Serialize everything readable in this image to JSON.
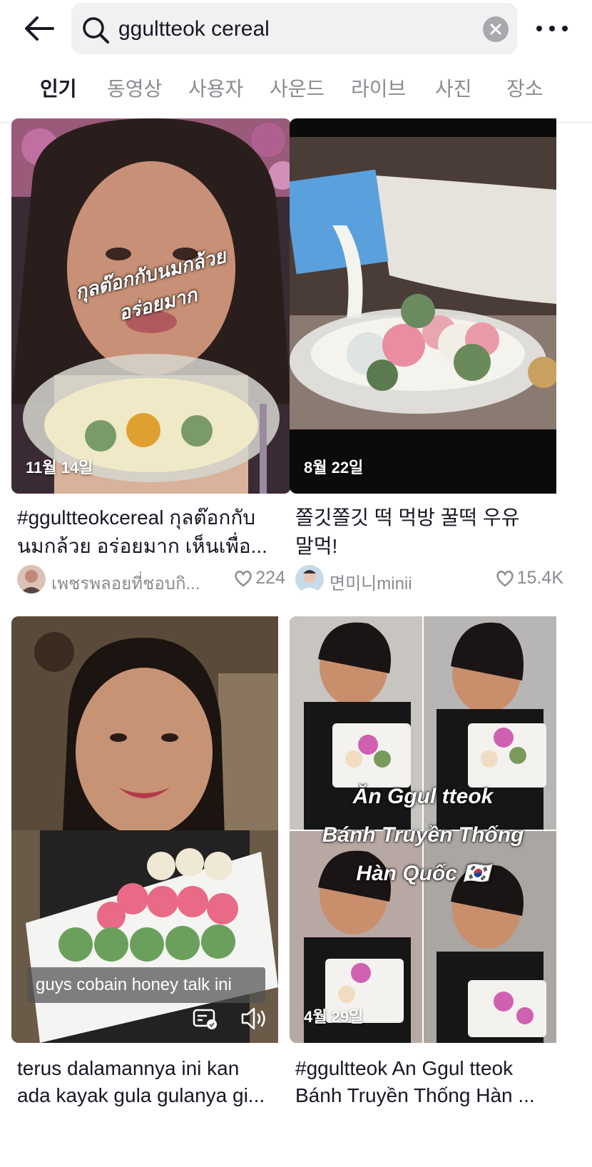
{
  "search": {
    "query": "ggultteok cereal"
  },
  "tabs": [
    {
      "label": "인기"
    },
    {
      "label": "동영상"
    },
    {
      "label": "사용자"
    },
    {
      "label": "사운드"
    },
    {
      "label": "라이브"
    },
    {
      "label": "사진"
    },
    {
      "label": "장소"
    }
  ],
  "active_tab": "인기",
  "cards": [
    {
      "date": "11월 14일",
      "overlay_lines": [
        "กุลต๊อกกับนมกล้วย",
        "อร่อยมาก"
      ],
      "title_line1": "#ggultteokcereal กุลต๊อกกับ",
      "title_line2": "นมกล้วย อร่อยมาก เห็นเพื่อ...",
      "author": "เพชรพลอยที่ชอบกิ...",
      "likes": "224"
    },
    {
      "date": "8월 22일",
      "title_line1": " 쫄깃쫄깃 떡 먹방 꿀떡 우유",
      "title_line2": "말먹!",
      "author": "면미니minii",
      "likes": "15.4K"
    },
    {
      "caption_overlay": "guys cobain honey talk ini",
      "title_line1": "terus dalamannya ini kan",
      "title_line2": "ada kayak gula gulanya gi..."
    },
    {
      "date": "4월 29일",
      "overlay_lines": [
        "Ăn Ggul tteok",
        "Bánh Truyền Thống",
        "Hàn Quốc 🇰🇷"
      ],
      "title_line1": "#ggultteok An Ggul tteok",
      "title_line2": "Bánh Truyền Thống Hàn ..."
    }
  ],
  "colors": {
    "text_primary": "#161823",
    "text_secondary": "#8a8b91",
    "search_bg": "#f1f1f2"
  }
}
